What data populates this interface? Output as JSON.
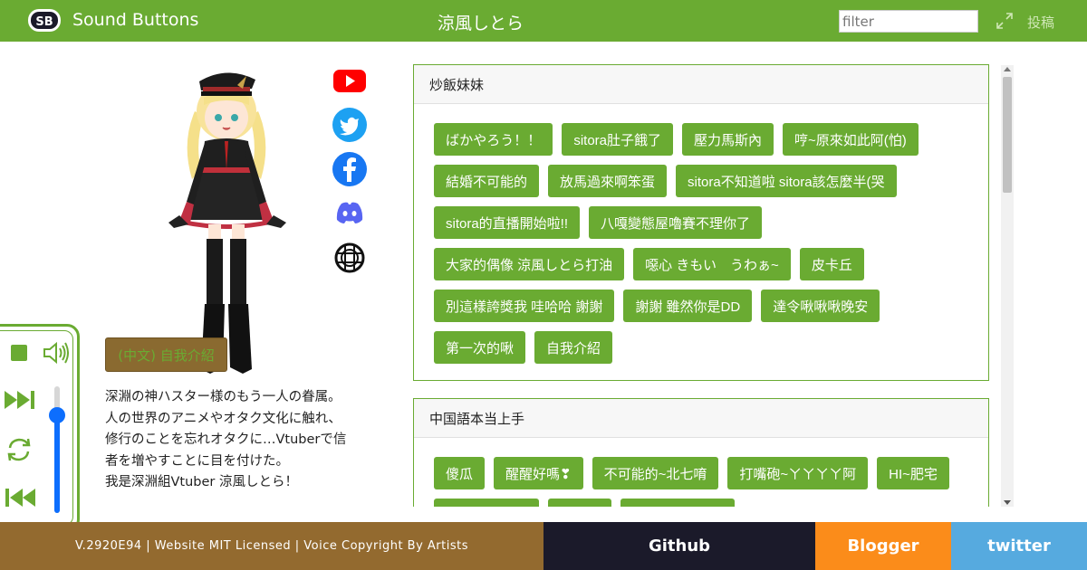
{
  "header": {
    "brand": "Sound Buttons",
    "title": "涼風しとら",
    "filter_placeholder": "filter",
    "post_label": "投稿"
  },
  "profile": {
    "intro_button": "(中文) 自我介紹",
    "bio": "深淵の神ハスター様のもう一人の眷属。人の世界のアニメやオタク文化に触れ、修行のことを忘れオタクに…Vtuberで信者を増やすことに目を付けた。\n我是深淵組Vtuber 涼風しとら！",
    "social_links": [
      "youtube-icon",
      "twitter-icon",
      "facebook-icon",
      "discord-icon",
      "website-icon"
    ]
  },
  "groups": [
    {
      "title": "炒飯妹妹",
      "buttons": [
        "ばかやろう！！",
        "sitora肚子餓了",
        "壓力馬斯內",
        "哼~原來如此阿(怕)",
        "結婚不可能的",
        "放馬過來啊笨蛋",
        "sitora不知道啦 sitora該怎麼半(哭",
        "sitora的直播開始啦!!",
        "八嘎變態屋嚕賽不理你了",
        "大家的偶像 涼風しとら打油",
        "噁心 きもい　うわぁ~",
        "皮卡丘",
        "別這樣誇獎我 哇哈哈 謝謝",
        "謝謝 雖然你是DD",
        "達令啾啾啾晚安",
        "第一次的啾",
        "自我介紹"
      ]
    },
    {
      "title": "中国語本当上手",
      "buttons": [
        "傻瓜",
        "醒醒好嗎❣",
        "不可能的~北七唷",
        "打嘴砲~ㄚㄚㄚㄚ阿",
        "HI~肥宅",
        "",
        "",
        ""
      ]
    }
  ],
  "footer": {
    "copyright": "V.2920E94 | Website MIT Licensed | Voice Copyright By Artists",
    "github": "Github",
    "blogger": "Blogger",
    "twitter": "twitter"
  },
  "colors": {
    "brand_green": "#6aab32",
    "brown": "#936a2f",
    "dark": "#1b1a2a",
    "orange": "#fb8c1a",
    "sky": "#56aadf"
  }
}
